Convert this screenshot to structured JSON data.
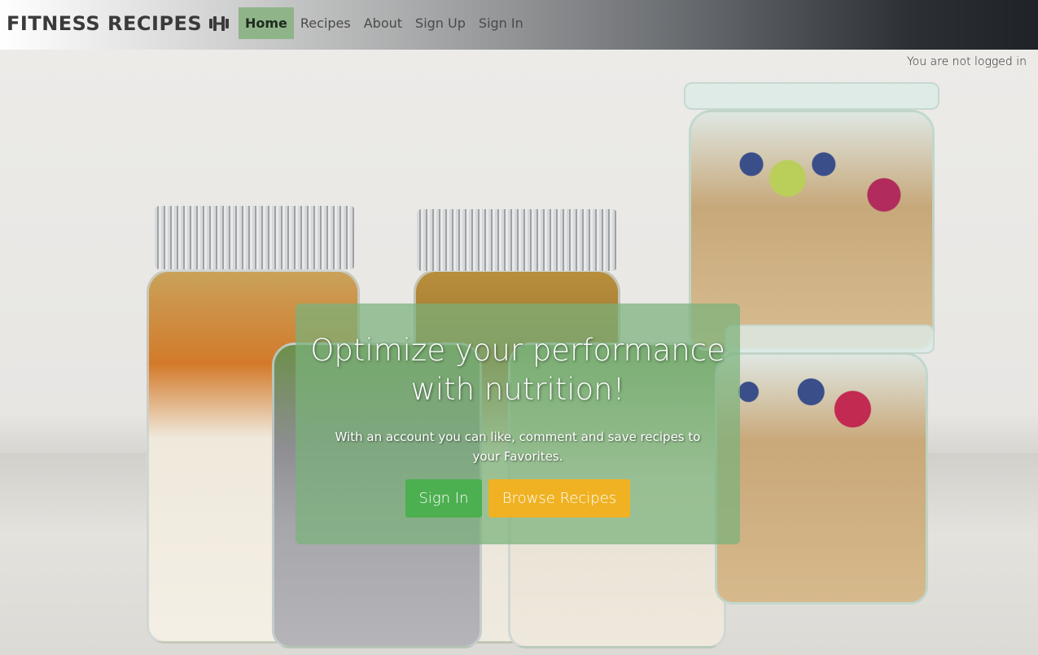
{
  "brand": {
    "name": "FITNESS RECIPES",
    "icon": "dumbbell-icon"
  },
  "nav": {
    "items": [
      {
        "label": "Home",
        "active": true
      },
      {
        "label": "Recipes",
        "active": false
      },
      {
        "label": "About",
        "active": false
      },
      {
        "label": "Sign Up",
        "active": false
      },
      {
        "label": "Sign In",
        "active": false
      }
    ]
  },
  "status": {
    "login": "You are not logged in"
  },
  "hero": {
    "title": "Optimize your performance with nutrition!",
    "text": "With an account you can like, comment and save recipes to your Favorites.",
    "primary_button": "Sign In",
    "secondary_button": "Browse Recipes"
  },
  "colors": {
    "active_nav": "#8fb48a",
    "cta_overlay": "#7ab27a",
    "signin_button": "#4caf50",
    "browse_button": "#f0b223"
  }
}
